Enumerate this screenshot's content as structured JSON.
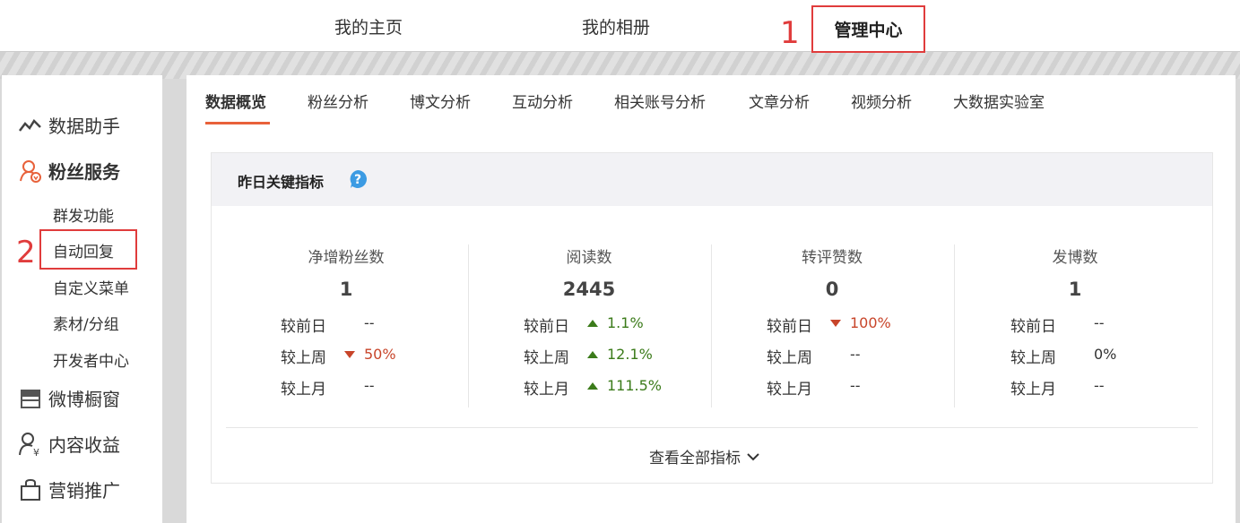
{
  "topnav": {
    "home": "我的主页",
    "album": "我的相册",
    "admin": "管理中心"
  },
  "annotations": {
    "one": "1",
    "two": "2"
  },
  "sidebar": {
    "sections": {
      "data": "数据助手",
      "fans": "粉丝服务",
      "window": "微博橱窗",
      "income": "内容收益",
      "promo": "营销推广"
    },
    "fans_items": [
      "群发功能",
      "自动回复",
      "自定义菜单",
      "素材/分组",
      "开发者中心"
    ]
  },
  "tabs": [
    "数据概览",
    "粉丝分析",
    "博文分析",
    "互动分析",
    "相关账号分析",
    "文章分析",
    "视频分析",
    "大数据实验室"
  ],
  "card": {
    "title": "昨日关键指标",
    "view_all": "查看全部指标",
    "compare_labels": [
      "较前日",
      "较上周",
      "较上月"
    ],
    "metrics": [
      {
        "title": "净增粉丝数",
        "value": "1",
        "compare": [
          {
            "text": "--",
            "trend": "none"
          },
          {
            "text": "50%",
            "trend": "down"
          },
          {
            "text": "--",
            "trend": "none"
          }
        ]
      },
      {
        "title": "阅读数",
        "value": "2445",
        "compare": [
          {
            "text": "1.1%",
            "trend": "up"
          },
          {
            "text": "12.1%",
            "trend": "up"
          },
          {
            "text": "111.5%",
            "trend": "up"
          }
        ]
      },
      {
        "title": "转评赞数",
        "value": "0",
        "compare": [
          {
            "text": "100%",
            "trend": "down"
          },
          {
            "text": "--",
            "trend": "none"
          },
          {
            "text": "--",
            "trend": "none"
          }
        ]
      },
      {
        "title": "发博数",
        "value": "1",
        "compare": [
          {
            "text": "--",
            "trend": "none"
          },
          {
            "text": "0%",
            "trend": "none"
          },
          {
            "text": "--",
            "trend": "none"
          }
        ]
      }
    ]
  },
  "colors": {
    "accent": "#e8613a",
    "up": "#3b7b1a",
    "down": "#c8452a",
    "annotation": "#e03c3c",
    "help": "#3c9be3"
  }
}
